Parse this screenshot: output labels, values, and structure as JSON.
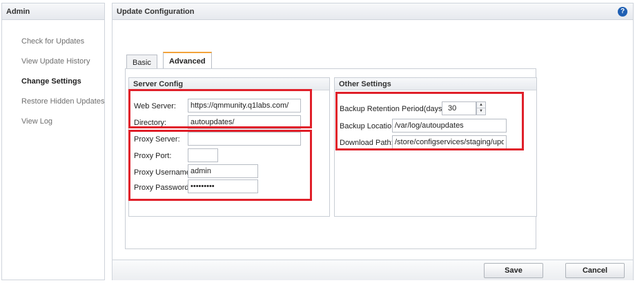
{
  "left_panel": {
    "title": "Admin",
    "items": [
      {
        "label": "Check for Updates",
        "active": false
      },
      {
        "label": "View Update History",
        "active": false
      },
      {
        "label": "Change Settings",
        "active": true
      },
      {
        "label": "Restore Hidden Updates",
        "active": false
      },
      {
        "label": "View Log",
        "active": false
      }
    ]
  },
  "main": {
    "title": "Update Configuration",
    "help_icon": "help-icon",
    "tabs": [
      {
        "label": "Basic",
        "active": false
      },
      {
        "label": "Advanced",
        "active": true
      }
    ]
  },
  "server_config": {
    "title": "Server Config",
    "web_server_label": "Web Server:",
    "web_server_value": "https://qmmunity.q1labs.com/",
    "directory_label": "Directory:",
    "directory_value": "autoupdates/",
    "proxy_server_label": "Proxy Server:",
    "proxy_server_value": "",
    "proxy_port_label": "Proxy Port:",
    "proxy_port_value": "",
    "proxy_username_label": "Proxy Username:",
    "proxy_username_value": "admin",
    "proxy_password_label": "Proxy Password:",
    "proxy_password_value": "•••••••••"
  },
  "other_settings": {
    "title": "Other Settings",
    "backup_retention_label": "Backup Retention Period(days):",
    "backup_retention_value": "30",
    "backup_location_label": "Backup Location:",
    "backup_location_value": "/var/log/autoupdates",
    "download_path_label": "Download Path:",
    "download_path_value": "/store/configservices/staging/update"
  },
  "footer": {
    "save_label": "Save",
    "cancel_label": "Cancel"
  },
  "colors": {
    "highlight": "#e0202a",
    "tab_accent": "#f2a23a",
    "help_icon": "#1f5fb3"
  }
}
